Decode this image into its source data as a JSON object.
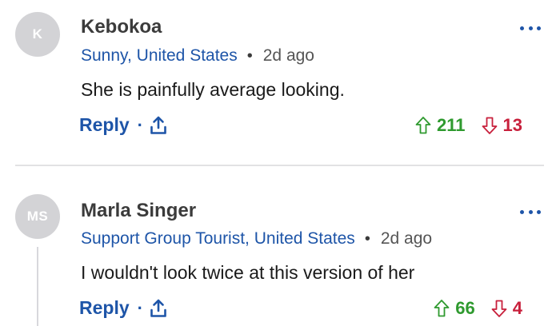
{
  "comments": [
    {
      "avatar_initials": "K",
      "author": "Kebokoa",
      "location": "Sunny, United States",
      "separator": "•",
      "age": "2d ago",
      "text": "She is painfully average looking.",
      "reply_label": "Reply",
      "action_separator": "·",
      "upvotes": "211",
      "downvotes": "13"
    },
    {
      "avatar_initials": "MS",
      "author": "Marla Singer",
      "location": "Support Group Tourist, United States",
      "separator": "•",
      "age": "2d ago",
      "text": "I wouldn't look twice at this version of her",
      "reply_label": "Reply",
      "action_separator": "·",
      "upvotes": "66",
      "downvotes": "4"
    }
  ],
  "icons": {
    "share": "share-icon",
    "upvote": "arrow-up-icon",
    "downvote": "arrow-down-icon",
    "more": "more-options-icon"
  },
  "colors": {
    "link_blue": "#1e55a8",
    "upvote_green": "#2f9a2f",
    "downvote_red": "#c8203c",
    "avatar_gray": "#d3d3d6"
  }
}
